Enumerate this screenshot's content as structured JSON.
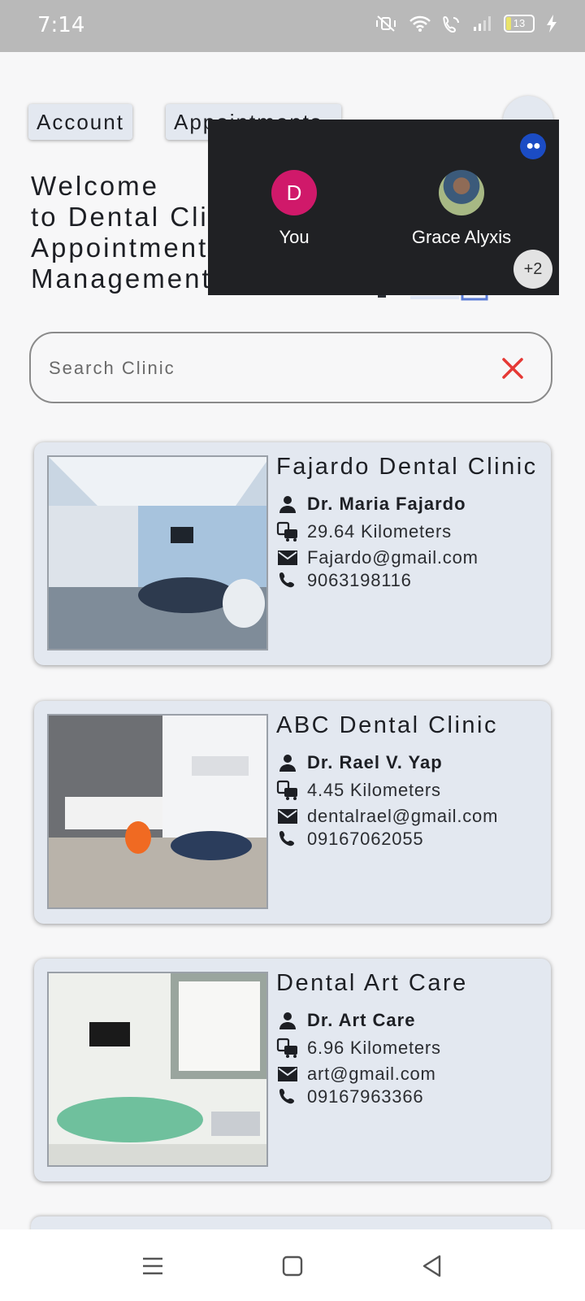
{
  "status_bar": {
    "time": "7:14",
    "battery": "13",
    "icons": [
      "mute-vibrate-icon",
      "wifi-icon",
      "wifi-call-icon",
      "signal-icon",
      "battery-icon",
      "charging-icon"
    ]
  },
  "tabs": {
    "account": "Account",
    "appointments": "Appointments"
  },
  "welcome": {
    "line1": "Welcome",
    "line2": "to Dental Clinic",
    "line3": "Appointment",
    "line4": "Management"
  },
  "call_overlay": {
    "participants": [
      {
        "initial": "D",
        "name": "You",
        "color": "#d0196a"
      },
      {
        "initial": "",
        "name": "Grace Alyxis"
      }
    ],
    "extra_count": "+2"
  },
  "search": {
    "placeholder": "Search Clinic",
    "value": ""
  },
  "colors": {
    "card_bg": "#e3e8f0",
    "clear_icon": "#e53935",
    "overlay_bg": "#202124"
  },
  "clinics": [
    {
      "name": "Fajardo Dental Clinic",
      "doctor": "Dr. Maria Fajardo",
      "distance": "29.64 Kilometers",
      "email": "Fajardo@gmail.com",
      "phone": "9063198116"
    },
    {
      "name": "ABC Dental Clinic",
      "doctor": "Dr. Rael V. Yap",
      "distance": "4.45 Kilometers",
      "email": "dentalrael@gmail.com",
      "phone": "09167062055"
    },
    {
      "name": "Dental Art Care",
      "doctor": "Dr. Art Care",
      "distance": "6.96 Kilometers",
      "email": "art@gmail.com",
      "phone": "09167963366"
    }
  ]
}
